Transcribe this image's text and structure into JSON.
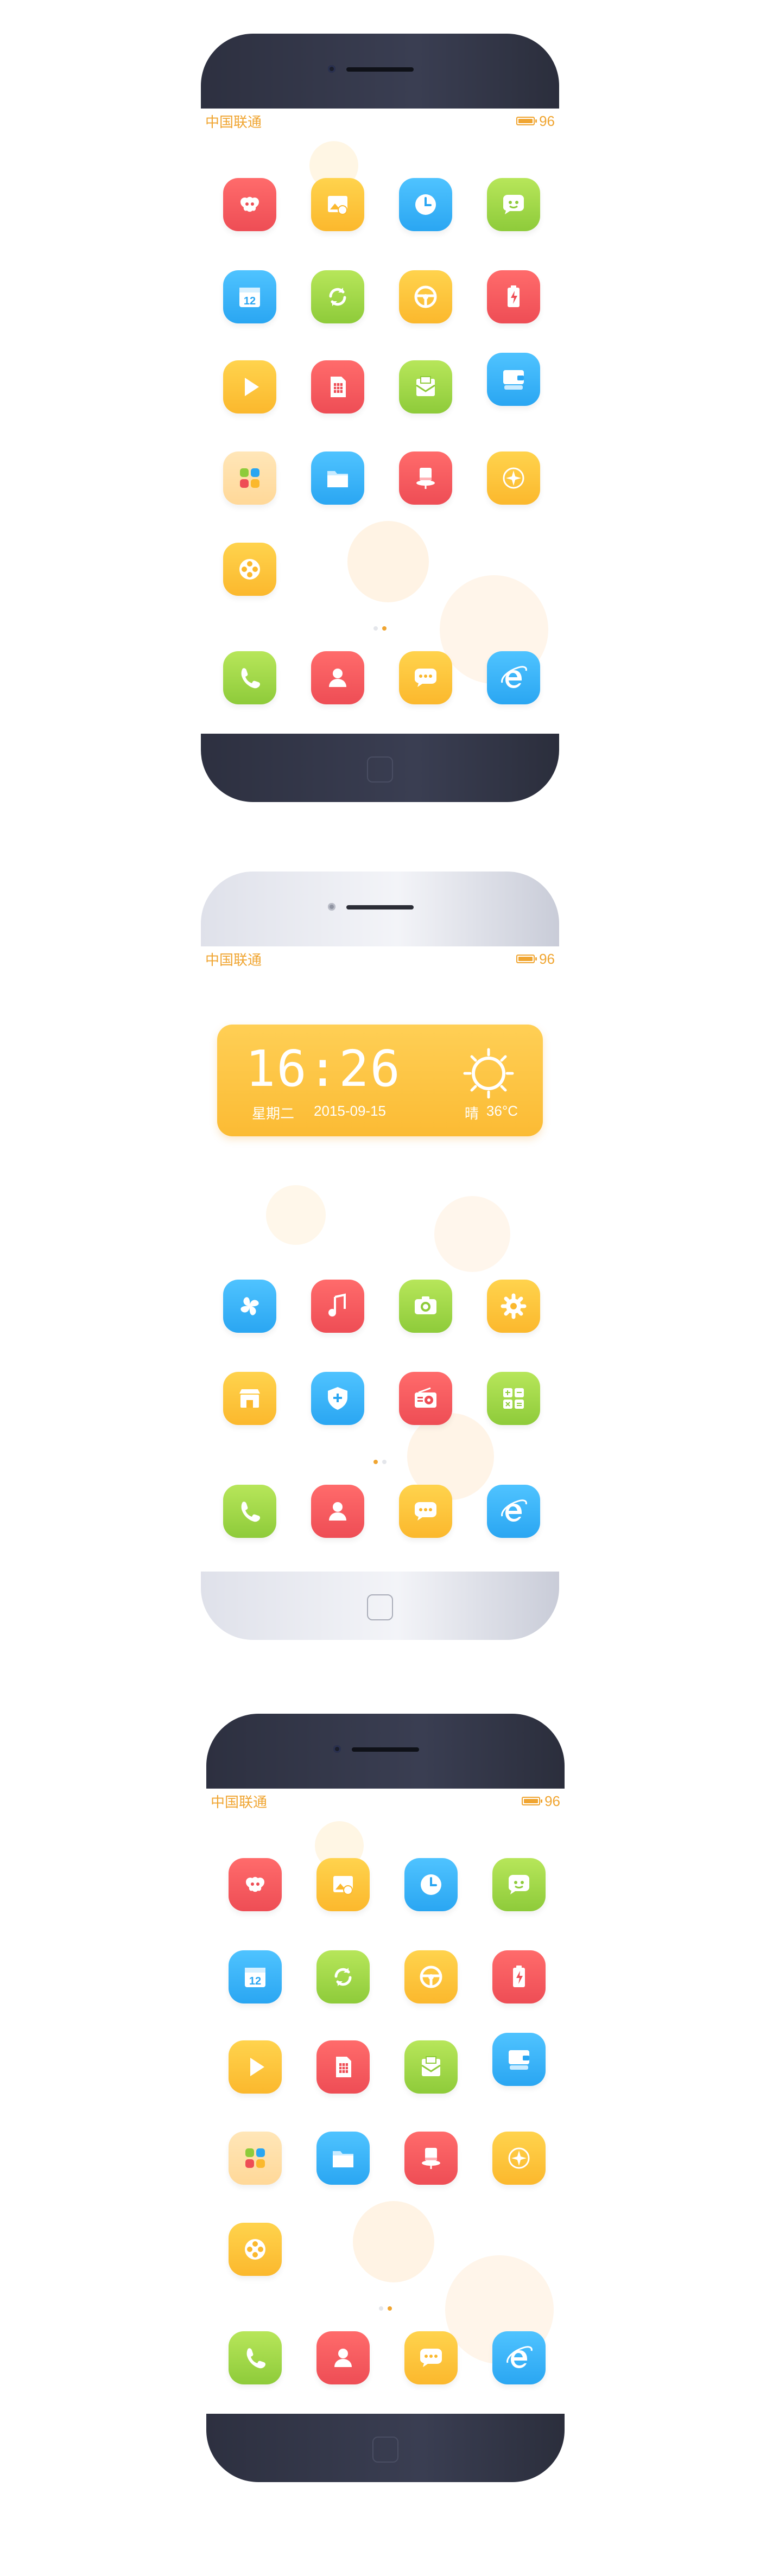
{
  "status": {
    "carrier": "中国联通",
    "battery": "96",
    "battery_level": 0.96
  },
  "colors": {
    "accent": "#f0a531",
    "red": "#ee4d55",
    "yellow": "#fbb82d",
    "blue": "#2aa6f2",
    "green": "#8ecb3a"
  },
  "widget": {
    "time": "16:26",
    "weekday": "星期二",
    "date": "2015-09-15",
    "condition": "晴",
    "temperature": "36°C"
  },
  "apps_grid": [
    {
      "icon": "game-pad-icon",
      "color": "red"
    },
    {
      "icon": "gallery-icon",
      "color": "yellow"
    },
    {
      "icon": "clock-icon",
      "color": "blue"
    },
    {
      "icon": "smiley-chat-icon",
      "color": "green"
    },
    {
      "icon": "calendar-icon",
      "color": "blue",
      "text": "12"
    },
    {
      "icon": "sync-icon",
      "color": "green"
    },
    {
      "icon": "steering-wheel-icon",
      "color": "yellow"
    },
    {
      "icon": "battery-icon",
      "color": "red"
    },
    {
      "icon": "play-icon",
      "color": "yellow"
    },
    {
      "icon": "sim-card-icon",
      "color": "red"
    },
    {
      "icon": "mail-icon",
      "color": "green"
    },
    {
      "icon": "wallet-icon",
      "color": "blue"
    },
    {
      "icon": "folder-grid-icon",
      "color": "cream"
    },
    {
      "icon": "file-folder-icon",
      "color": "blue"
    },
    {
      "icon": "magic-hat-icon",
      "color": "red"
    },
    {
      "icon": "compass-icon",
      "color": "yellow"
    },
    {
      "icon": "film-reel-icon",
      "color": "yellow"
    }
  ],
  "apps_second": [
    {
      "icon": "pinwheel-icon",
      "color": "blue"
    },
    {
      "icon": "music-icon",
      "color": "red"
    },
    {
      "icon": "camera-icon",
      "color": "green"
    },
    {
      "icon": "settings-gear-icon",
      "color": "yellow"
    },
    {
      "icon": "store-icon",
      "color": "yellow"
    },
    {
      "icon": "shield-icon",
      "color": "blue"
    },
    {
      "icon": "radio-icon",
      "color": "red"
    },
    {
      "icon": "calculator-icon",
      "color": "green"
    }
  ],
  "dock": [
    {
      "icon": "phone-icon",
      "color": "green"
    },
    {
      "icon": "contacts-icon",
      "color": "red"
    },
    {
      "icon": "messages-icon",
      "color": "yellow"
    },
    {
      "icon": "browser-icon",
      "color": "blue"
    }
  ]
}
